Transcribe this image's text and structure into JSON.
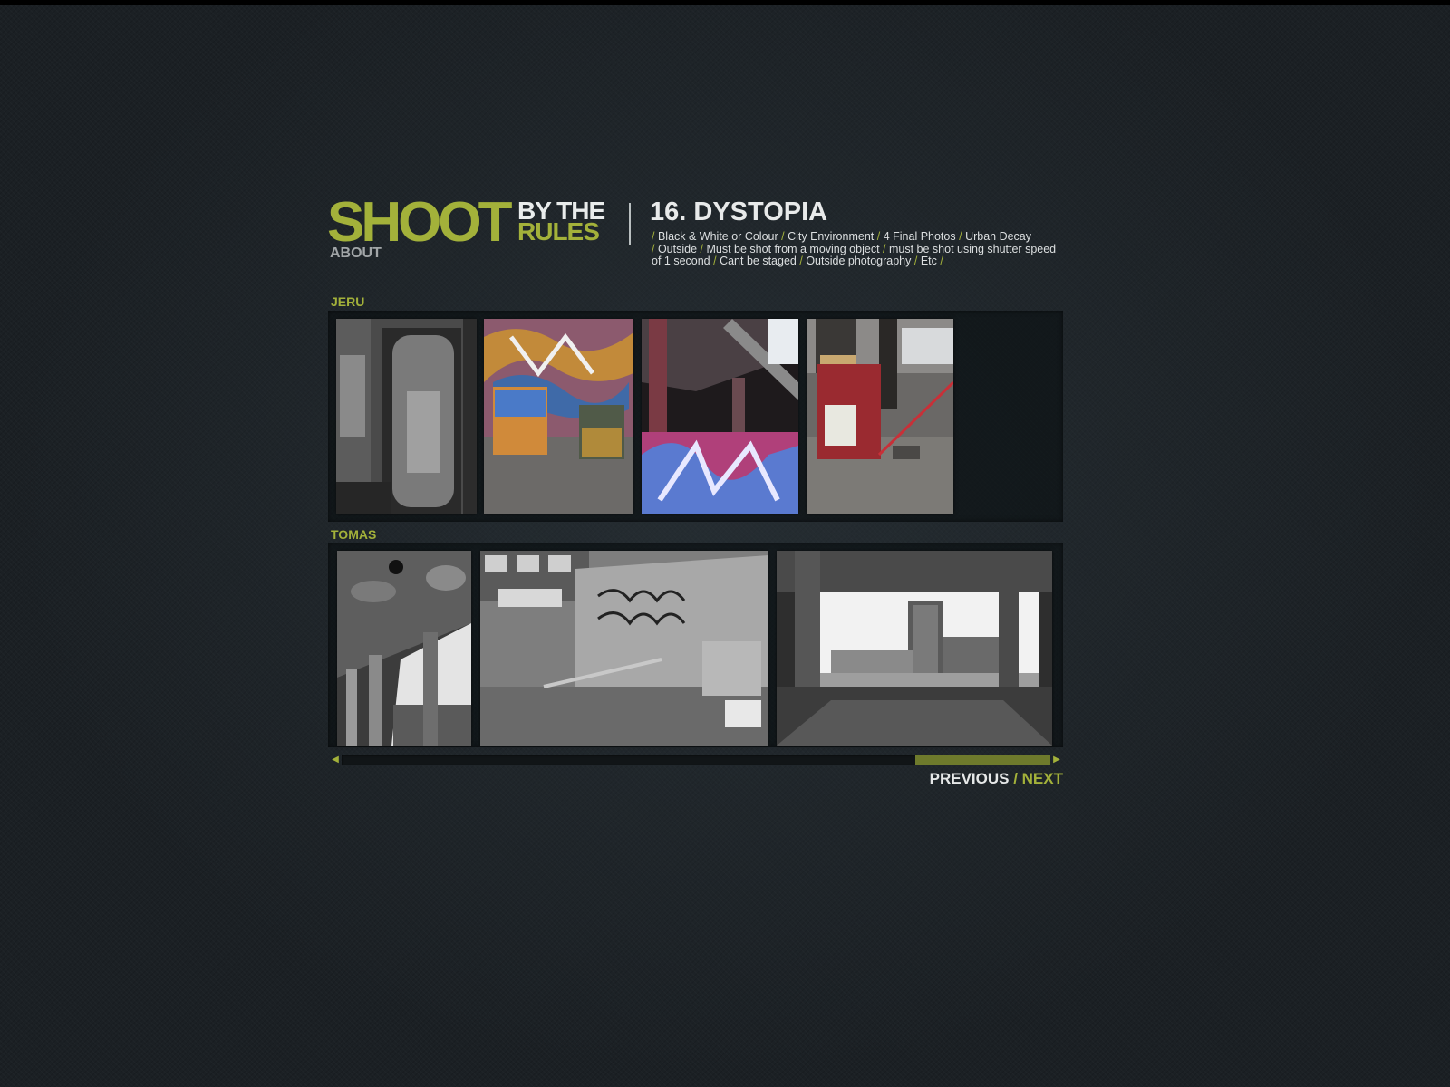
{
  "site": {
    "logo_shoot": "SHOOT",
    "logo_bythe": "BY THE",
    "logo_rules": "RULES",
    "about_label": "ABOUT"
  },
  "challenge": {
    "title": "16. DYSTOPIA",
    "rules": [
      "Black & White or Colour",
      "City Environment",
      "4 Final Photos",
      "Urban Decay",
      "Outside",
      "Must be shot from a moving object",
      "must be shot using shutter speed of 1 second",
      "Cant be staged",
      "Outside photography",
      "Etc"
    ]
  },
  "galleries": [
    {
      "photographer": "JERU",
      "photos": [
        {
          "name": "boarded-door-photo",
          "tone": "bw"
        },
        {
          "name": "graffiti-wall-bins-photo",
          "tone": "colour"
        },
        {
          "name": "bridge-graffiti-photo",
          "tone": "colour"
        },
        {
          "name": "abandoned-piano-photo",
          "tone": "colour"
        }
      ]
    },
    {
      "photographer": "TOMAS",
      "photos": [
        {
          "name": "concrete-colonnade-photo",
          "tone": "bw"
        },
        {
          "name": "graffiti-fence-rubble-photo",
          "tone": "bw"
        },
        {
          "name": "framed-building-photo",
          "tone": "bw"
        }
      ]
    }
  ],
  "scrollbar": {
    "left_arrow": "◀",
    "right_arrow": "▶",
    "position_fraction": 0.81,
    "visible_fraction": 0.19
  },
  "pager": {
    "previous_label": "PREVIOUS",
    "separator": " / ",
    "next_label": "NEXT"
  },
  "colors": {
    "accent": "#a3b13a",
    "background": "#1b2024",
    "text": "#e8eaea"
  }
}
